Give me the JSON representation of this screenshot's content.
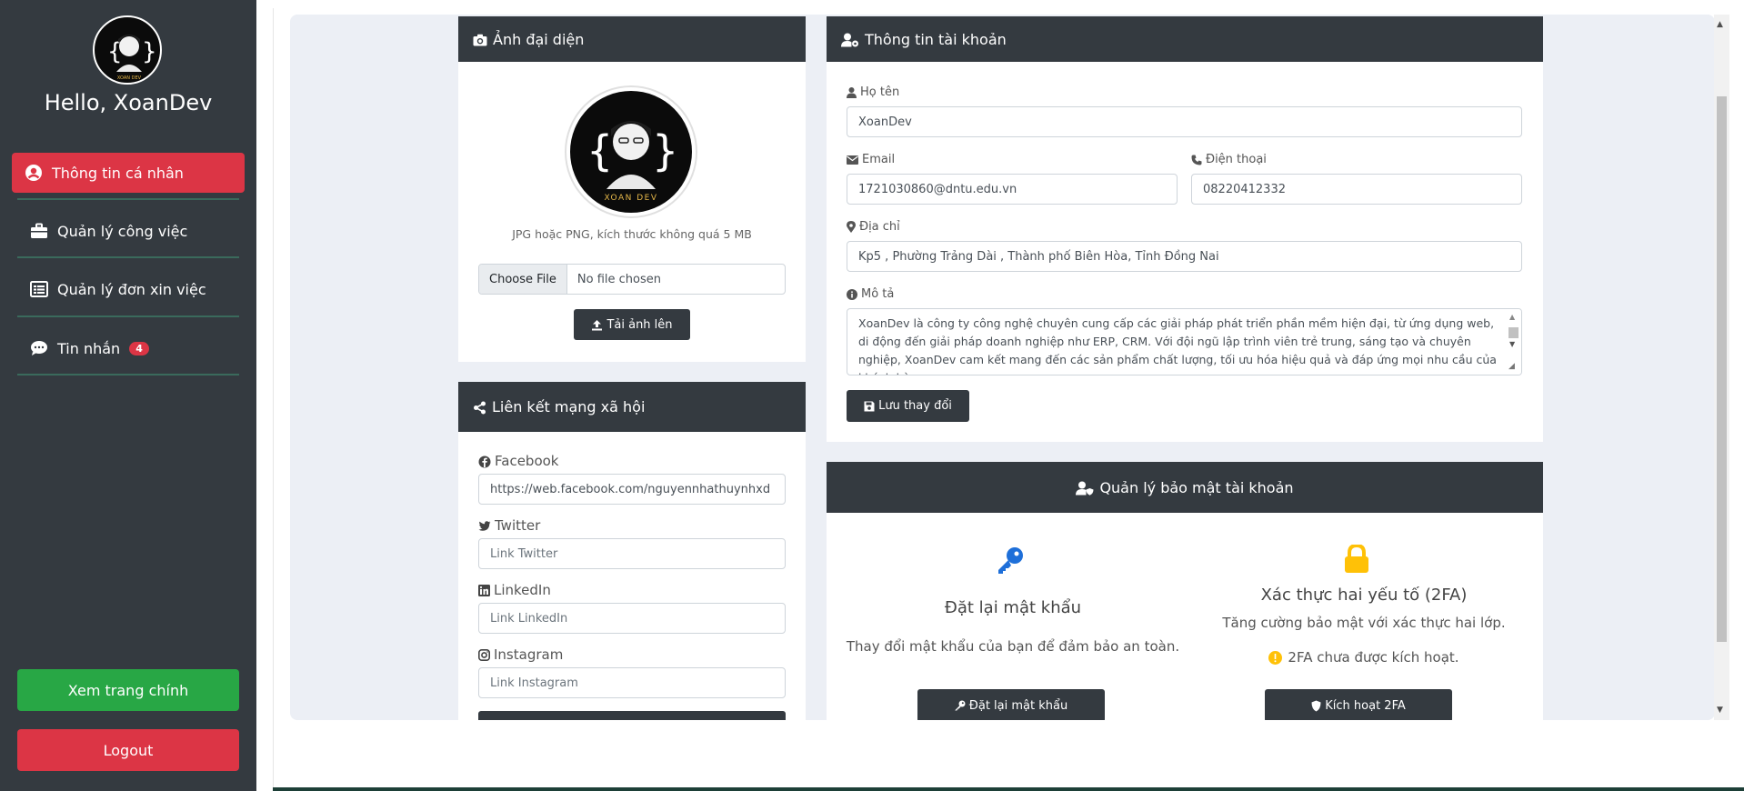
{
  "sidebar": {
    "greeting": "Hello, XoanDev",
    "avatar_text": "XOAN DEV",
    "items": [
      {
        "label": "Thông tin cá nhân",
        "icon": "user-circle-icon"
      },
      {
        "label": "Quản lý công việc",
        "icon": "briefcase-icon"
      },
      {
        "label": "Quản lý đơn xin việc",
        "icon": "list-icon"
      },
      {
        "label": "Tin nhắn",
        "icon": "chat-icon",
        "badge": "4"
      }
    ],
    "view_main_label": "Xem trang chính",
    "logout_label": "Logout"
  },
  "avatar_card": {
    "title": "Ảnh đại diện",
    "image_text": "XOAN DEV",
    "hint": "JPG hoặc PNG, kích thước không quá 5 MB",
    "choose_file_label": "Choose File",
    "no_file_label": "No file chosen",
    "upload_label": "Tải ảnh lên"
  },
  "social_card": {
    "title": "Liên kết mạng xã hội",
    "fields": [
      {
        "label": "Facebook",
        "value": "https://web.facebook.com/nguyennhathuynhxd",
        "placeholder": ""
      },
      {
        "label": "Twitter",
        "value": "",
        "placeholder": "Link Twitter"
      },
      {
        "label": "LinkedIn",
        "value": "",
        "placeholder": "Link LinkedIn"
      },
      {
        "label": "Instagram",
        "value": "",
        "placeholder": "Link Instagram"
      }
    ]
  },
  "account_card": {
    "title": "Thông tin tài khoản",
    "name_label": "Họ tên",
    "name_value": "XoanDev",
    "email_label": "Email",
    "email_value": "1721030860@dntu.edu.vn",
    "phone_label": "Điện thoại",
    "phone_value": "08220412332",
    "address_label": "Địa chỉ",
    "address_value": "Kp5 , Phường Trảng Dài , Thành phố Biên Hòa, Tỉnh Đồng Nai",
    "desc_label": "Mô tả",
    "desc_value": "XoanDev là công ty công nghệ chuyên cung cấp các giải pháp phát triển phần mềm hiện đại, từ ứng dụng web, di động đến giải pháp doanh nghiệp như ERP, CRM. Với đội ngũ lập trình viên trẻ trung, sáng tạo và chuyên nghiệp, XoanDev cam kết mang đến các sản phẩm chất lượng, tối ưu hóa hiệu quả và đáp ứng mọi nhu cầu của khách hàng.",
    "save_label": "Lưu thay đổi"
  },
  "security_card": {
    "title": "Quản lý bảo mật tài khoản",
    "reset_title": "Đặt lại mật khẩu",
    "reset_desc": "Thay đổi mật khẩu của bạn để đảm bảo an toàn.",
    "reset_button": "Đặt lại mật khẩu",
    "tfa_title": "Xác thực hai yếu tố (2FA)",
    "tfa_desc": "Tăng cường bảo mật với xác thực hai lớp.",
    "tfa_status": "2FA chưa được kích hoạt.",
    "tfa_button": "Kích hoạt 2FA"
  },
  "colors": {
    "sidebar_bg": "#343a40",
    "active_red": "#dc3545",
    "green": "#28a745",
    "key_blue": "#1e6fd9",
    "lock_yellow": "#ffc107"
  }
}
